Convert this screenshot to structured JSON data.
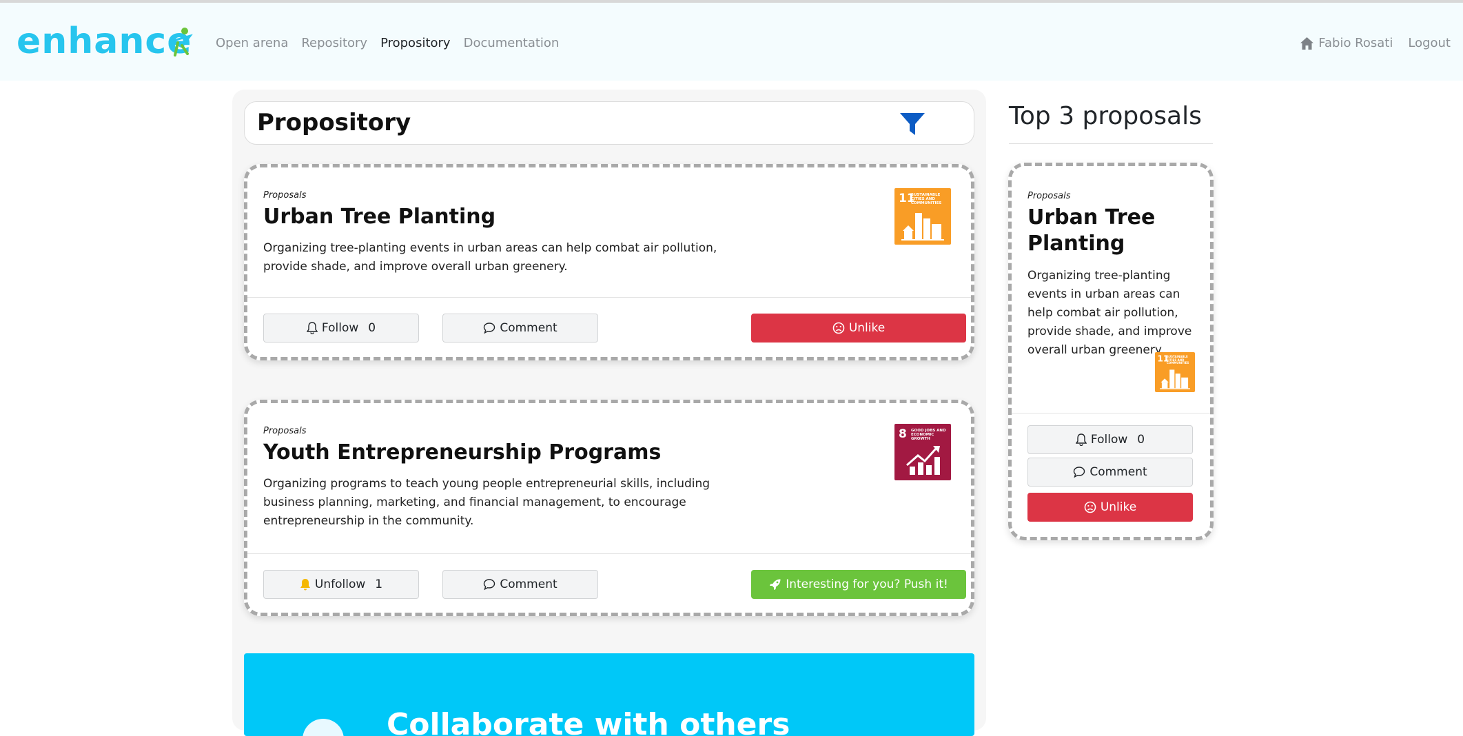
{
  "nav": {
    "brand": "enhance",
    "links": [
      "Open arena",
      "Repository",
      "Propository",
      "Documentation"
    ],
    "active_index": 2,
    "user_name": "Fabio Rosati",
    "logout_label": "Logout"
  },
  "main": {
    "title": "Propository",
    "proposals": [
      {
        "kicker": "Proposals",
        "title": "Urban Tree Planting",
        "description": "Organizing tree-planting events in urban areas can help combat air pollution, provide shade, and improve overall urban greenery.",
        "sdg_number": "11",
        "sdg_label": "SUSTAINABLE CITIES AND COMMUNITIES",
        "sdg_color": "#f99d26",
        "follow_label": "Follow",
        "follow_count": "0",
        "comment_label": "Comment",
        "action_label": "Unlike"
      },
      {
        "kicker": "Proposals",
        "title": "Youth Entrepreneurship Programs",
        "description": "Organizing programs to teach young people entrepreneurial skills, including business planning, marketing, and financial management, to encourage entrepreneurship in the community.",
        "sdg_number": "8",
        "sdg_label": "GOOD JOBS AND ECONOMIC GROWTH",
        "sdg_color": "#a21942",
        "follow_label": "Unfollow",
        "follow_count": "1",
        "comment_label": "Comment",
        "action_label": "Interesting for you? Push it!"
      }
    ],
    "cta_text": "Collaborate with others"
  },
  "sidebar": {
    "title": "Top 3 proposals",
    "card": {
      "kicker": "Proposals",
      "title": "Urban Tree Planting",
      "description": "Organizing tree-planting events in urban areas can help combat air pollution, provide shade, and improve overall urban greenery.",
      "sdg_number": "11",
      "sdg_label": "SUSTAINABLE CITIES AND COMMUNITIES",
      "follow_label": "Follow",
      "follow_count": "0",
      "comment_label": "Comment",
      "action_label": "Unlike"
    }
  },
  "colors": {
    "brand": "#27c5ee",
    "unlike": "#dc3545",
    "push": "#6bc43c",
    "filter": "#0d5cc4",
    "cta": "#00c8f8"
  }
}
